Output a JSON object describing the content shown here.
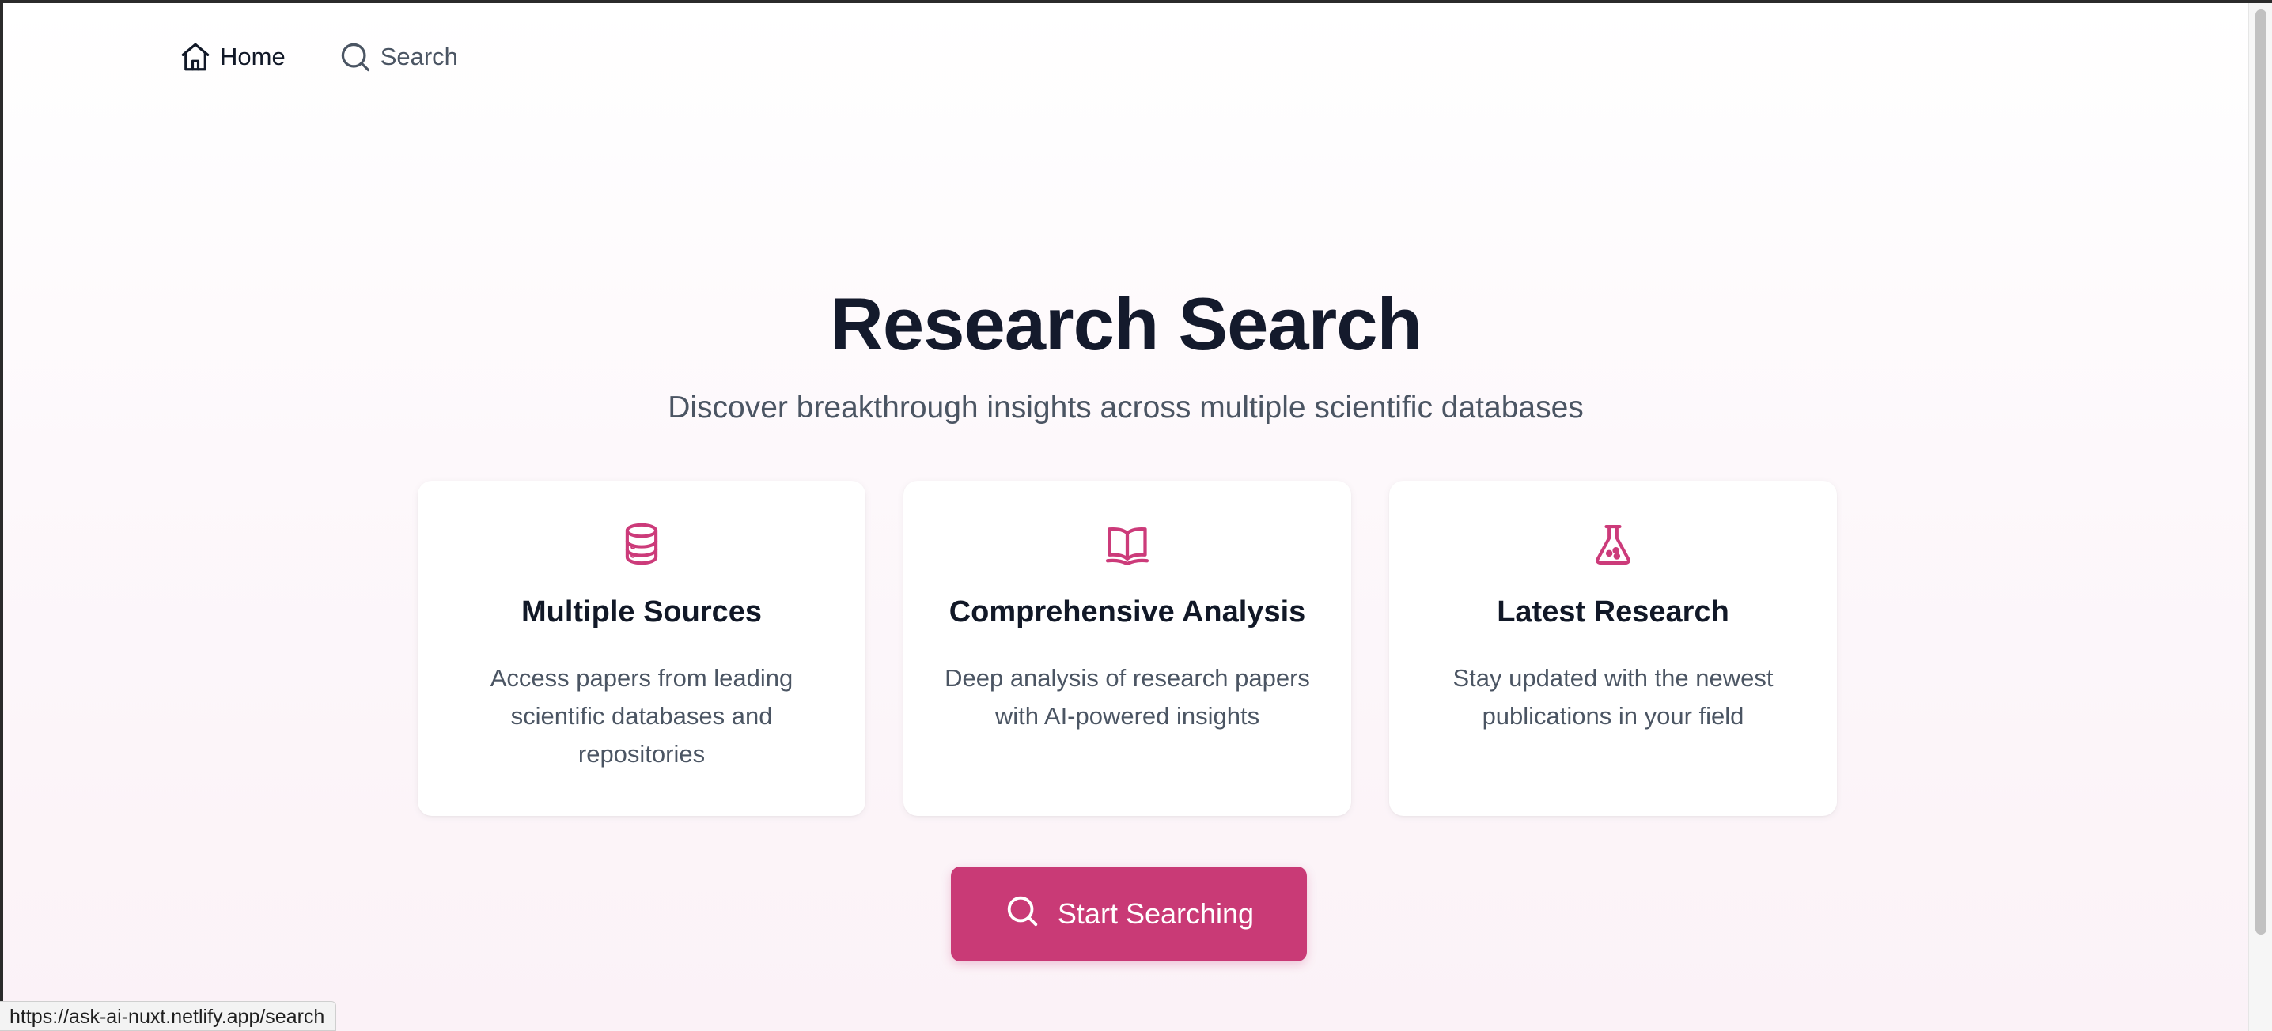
{
  "nav": {
    "home_label": "Home",
    "search_label": "Search"
  },
  "hero": {
    "title": "Research Search",
    "subtitle": "Discover breakthrough insights across multiple scientific databases"
  },
  "features": [
    {
      "icon": "database-icon",
      "title": "Multiple Sources",
      "description": "Access papers from leading scientific databases and repositories"
    },
    {
      "icon": "open-book-icon",
      "title": "Comprehensive Analysis",
      "description": "Deep analysis of research papers with AI-powered insights"
    },
    {
      "icon": "flask-icon",
      "title": "Latest Research",
      "description": "Stay updated with the newest publications in your field"
    }
  ],
  "cta": {
    "label": "Start Searching",
    "icon": "search-icon"
  },
  "status_bar": {
    "url": "https://ask-ai-nuxt.netlify.app/search"
  },
  "colors": {
    "accent": "#c93a76",
    "icon_accent": "#cc3b7a",
    "heading": "#141a2c",
    "body_text": "#4b5563"
  }
}
